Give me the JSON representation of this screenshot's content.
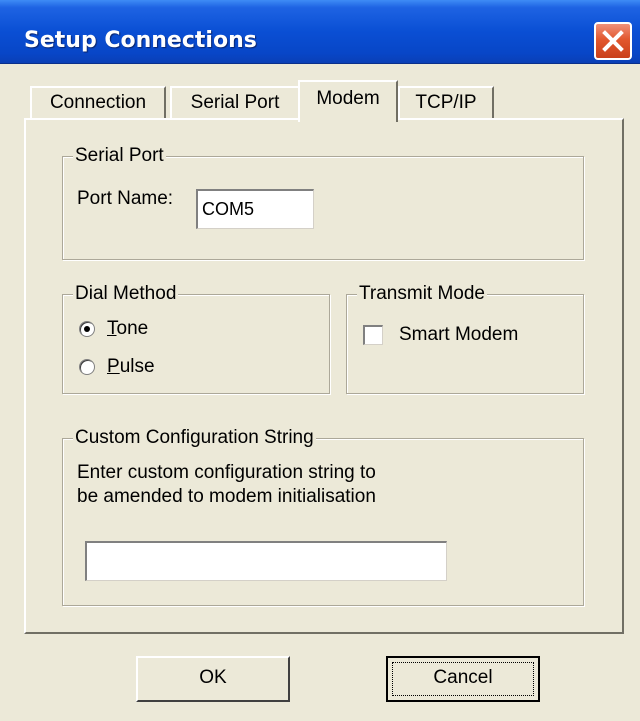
{
  "window": {
    "title": "Setup Connections",
    "close_icon": "close-icon",
    "title_color": "#0a4fd4",
    "close_color": "#e2582e"
  },
  "tabs": [
    {
      "label": "Connection",
      "active": false
    },
    {
      "label": "Serial Port",
      "active": false
    },
    {
      "label": "Modem",
      "active": true
    },
    {
      "label": "TCP/IP",
      "active": false
    }
  ],
  "serial_port_group": {
    "legend": "Serial Port",
    "port_name_label": "Port Name:",
    "port_name_value": "COM5"
  },
  "dial_method_group": {
    "legend": "Dial Method",
    "tone_label_first": "T",
    "tone_label_rest": "one",
    "pulse_label_first": "P",
    "pulse_label_rest": "ulse",
    "selected": "Tone"
  },
  "transmit_mode_group": {
    "legend": "Transmit Mode",
    "smart_modem_label": "Smart Modem",
    "smart_modem_checked": false
  },
  "custom_config_group": {
    "legend": "Custom Configuration String",
    "description_line1": "Enter custom configuration string  to",
    "description_line2": "be amended to modem  initialisation",
    "value": ""
  },
  "buttons": {
    "ok_label": "OK",
    "cancel_label": "Cancel"
  }
}
